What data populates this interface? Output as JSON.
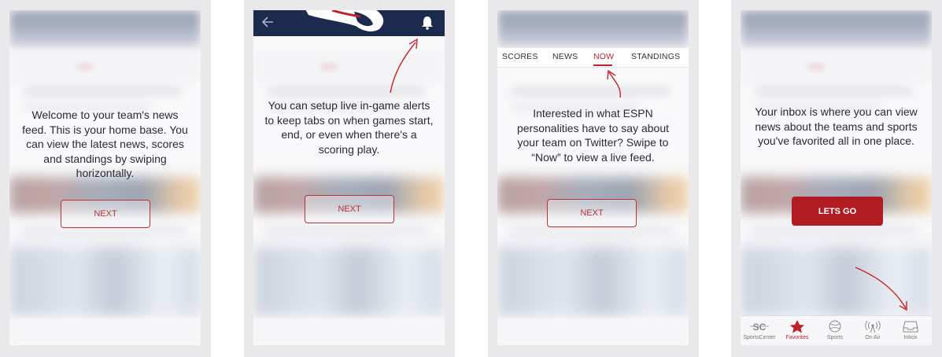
{
  "panels": [
    {
      "message": "Welcome to your team's news feed. This is your home base. You can view the latest news, scores and standings by swiping horizontally.",
      "button": "NEXT"
    },
    {
      "message": "You can setup live in-game alerts to keep tabs on when games start, end, or even when there's a scoring play.",
      "button": "NEXT",
      "header": {
        "back_icon": "back-arrow-icon",
        "bell_icon": "bell-icon"
      }
    },
    {
      "message": "Interested in what ESPN personalities have to say about your team on Twitter? Swipe to “Now” to view a live feed.",
      "button": "NEXT",
      "tabs": [
        "SCORES",
        "NEWS",
        "NOW",
        "STANDINGS"
      ],
      "active_tab": "NOW"
    },
    {
      "message": "Your inbox is where you can view news about the teams and sports you've favorited all in one place.",
      "button": "LETS GO",
      "nav": [
        {
          "label": "SportsCenter",
          "icon": "sportscenter-icon"
        },
        {
          "label": "Favorites",
          "icon": "star-icon"
        },
        {
          "label": "Sports",
          "icon": "sports-ball-icon"
        },
        {
          "label": "On Air",
          "icon": "broadcast-icon"
        },
        {
          "label": "Inbox",
          "icon": "inbox-icon"
        }
      ],
      "active_nav": "Favorites"
    }
  ],
  "colors": {
    "accent": "#b8323a",
    "team_navy": "#1b2a4d",
    "annotation_arrow": "#c8232c"
  }
}
